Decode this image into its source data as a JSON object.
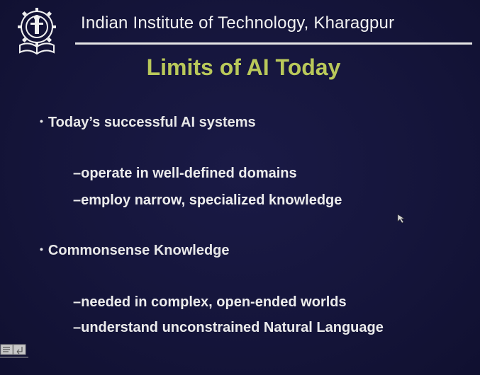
{
  "header": {
    "institute": "Indian Institute of Technology, Kharagpur"
  },
  "slide": {
    "title": "Limits of AI Today",
    "bullets": [
      {
        "text": "Today’s successful AI systems",
        "subs": [
          "–operate in well-defined domains",
          "–employ narrow, specialized knowledge"
        ]
      },
      {
        "text": "Commonsense Knowledge",
        "subs": [
          "–needed in complex, open-ended worlds",
          "–understand unconstrained Natural Language"
        ]
      }
    ]
  },
  "icons": {
    "logo": "iit-kharagpur-logo",
    "cursor": "mouse-cursor-icon",
    "nav": "slide-navigation-icon"
  },
  "colors": {
    "background": "#15153b",
    "title": "#b9c85a",
    "text": "#e8e8e8"
  }
}
